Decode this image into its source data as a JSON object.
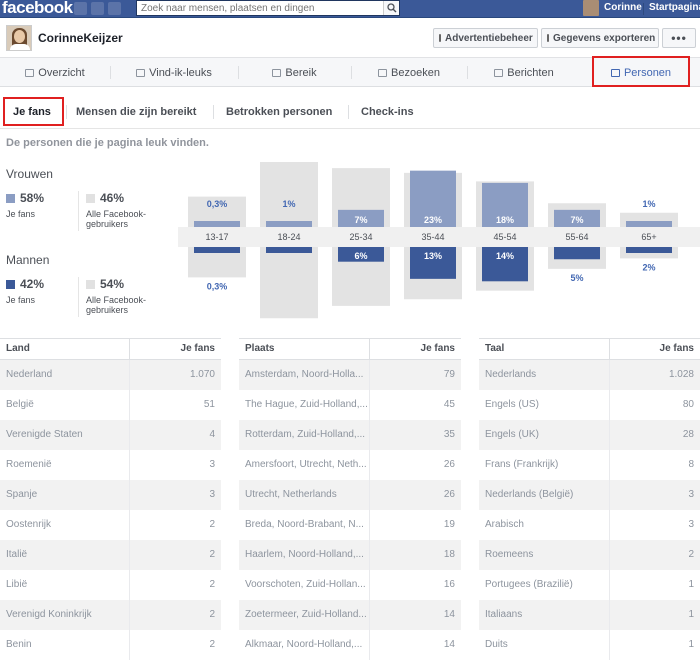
{
  "topbar": {
    "logo": "facebook",
    "search_placeholder": "Zoek naar mensen, plaatsen en dingen",
    "user": "Corinne",
    "home": "Startpagina"
  },
  "page": {
    "name": "CorinneKeijzer",
    "buttons": [
      "Advertentiebeheer",
      "Gegevens exporteren",
      "•••"
    ]
  },
  "nav_tabs": [
    {
      "label": "Overzicht",
      "icon": "flag-icon"
    },
    {
      "label": "Vind-ik-leuks",
      "icon": "thumbs-up-icon"
    },
    {
      "label": "Bereik",
      "icon": "people-icon"
    },
    {
      "label": "Bezoeken",
      "icon": "bar-chart-icon"
    },
    {
      "label": "Berichten",
      "icon": "document-icon"
    },
    {
      "label": "Personen",
      "icon": "people-icon",
      "active": true
    }
  ],
  "sub_tabs": [
    {
      "label": "Je fans",
      "active": true
    },
    {
      "label": "Mensen die zijn bereikt"
    },
    {
      "label": "Betrokken personen"
    },
    {
      "label": "Check-ins"
    }
  ],
  "caption": "De personen die je pagina leuk vinden.",
  "gender": {
    "women": {
      "title": "Vrouwen",
      "fans_pct": "58%",
      "fans_label": "Je fans",
      "all_pct": "46%",
      "all_label": "Alle Facebook-gebruikers"
    },
    "men": {
      "title": "Mannen",
      "fans_pct": "42%",
      "fans_label": "Je fans",
      "all_pct": "54%",
      "all_label": "Alle Facebook-gebruikers"
    }
  },
  "colors": {
    "women": "#8b9dc3",
    "men": "#3b5998",
    "all_users": "#e1e1e1",
    "highlight_red": "#e02020",
    "accent_blue": "#4267b2"
  },
  "chart_data": {
    "type": "bar",
    "categories": [
      "13-17",
      "18-24",
      "25-34",
      "35-44",
      "45-54",
      "55-64",
      "65+"
    ],
    "series": [
      {
        "name": "Vrouwen",
        "values": [
          0.3,
          1,
          7,
          23,
          18,
          7,
          1
        ]
      },
      {
        "name": "Mannen",
        "values": [
          0.3,
          2,
          6,
          13,
          14,
          5,
          2
        ]
      }
    ],
    "labels_women": [
      "0,3%",
      "1%",
      "7%",
      "23%",
      "18%",
      "7%",
      "1%"
    ],
    "labels_men": [
      "0,3%",
      "2%",
      "6%",
      "13%",
      "14%",
      "5%",
      "2%"
    ],
    "all_users_women": [
      3.2,
      7.5,
      6.2,
      5.7,
      4.8,
      2.5,
      1.5
    ],
    "all_users_men": [
      3.2,
      7.5,
      6.2,
      5.5,
      4.6,
      2.3,
      1.2
    ]
  },
  "tables": [
    {
      "col1": "Land",
      "col2": "Je fans",
      "rows": [
        [
          "Nederland",
          "1.070"
        ],
        [
          "België",
          "51"
        ],
        [
          "Verenigde Staten",
          "4"
        ],
        [
          "Roemenië",
          "3"
        ],
        [
          "Spanje",
          "3"
        ],
        [
          "Oostenrijk",
          "2"
        ],
        [
          "Italië",
          "2"
        ],
        [
          "Libië",
          "2"
        ],
        [
          "Verenigd Koninkrijk",
          "2"
        ],
        [
          "Benin",
          "2"
        ]
      ]
    },
    {
      "col1": "Plaats",
      "col2": "Je fans",
      "rows": [
        [
          "Amsterdam, Noord-Holla...",
          "79"
        ],
        [
          "The Hague, Zuid-Holland,...",
          "45"
        ],
        [
          "Rotterdam, Zuid-Holland,...",
          "35"
        ],
        [
          "Amersfoort, Utrecht, Neth...",
          "26"
        ],
        [
          "Utrecht, Netherlands",
          "26"
        ],
        [
          "Breda, Noord-Brabant, N...",
          "19"
        ],
        [
          "Haarlem, Noord-Holland,...",
          "18"
        ],
        [
          "Voorschoten, Zuid-Hollan...",
          "16"
        ],
        [
          "Zoetermeer, Zuid-Holland...",
          "14"
        ],
        [
          "Alkmaar, Noord-Holland,...",
          "14"
        ]
      ]
    },
    {
      "col1": "Taal",
      "col2": "Je fans",
      "rows": [
        [
          "Nederlands",
          "1.028"
        ],
        [
          "Engels (US)",
          "80"
        ],
        [
          "Engels (UK)",
          "28"
        ],
        [
          "Frans (Frankrijk)",
          "8"
        ],
        [
          "Nederlands (België)",
          "3"
        ],
        [
          "Arabisch",
          "3"
        ],
        [
          "Roemeens",
          "2"
        ],
        [
          "Portugees (Brazilië)",
          "1"
        ],
        [
          "Italiaans",
          "1"
        ],
        [
          "Duits",
          "1"
        ]
      ]
    }
  ]
}
